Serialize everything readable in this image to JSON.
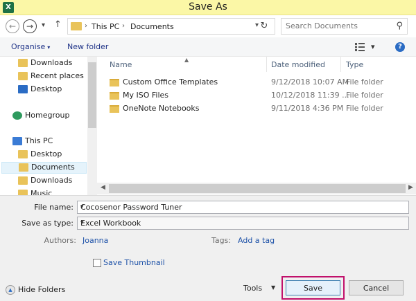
{
  "window": {
    "title": "Save As",
    "app_icon": "X"
  },
  "nav": {
    "back_glyph": "←",
    "forward_glyph": "→",
    "history_glyph": "▾",
    "up_glyph": "↑",
    "path": [
      "This PC",
      "Documents"
    ],
    "separator": "›",
    "address_dropdown": "▾",
    "refresh_glyph": "↻",
    "search_placeholder": "Search Documents",
    "search_glyph": "⚲"
  },
  "toolbar": {
    "organise_label": "Organise",
    "organise_dd": "▾",
    "new_folder_label": "New folder",
    "view_dd": "▾",
    "help_glyph": "?"
  },
  "sidebar": {
    "items": [
      {
        "label": "Downloads",
        "icon": "folder-download-icon",
        "color": "#e9c35a"
      },
      {
        "label": "Recent places",
        "icon": "recent-places-icon",
        "color": "#e9c35a"
      },
      {
        "label": "Desktop",
        "icon": "desktop-icon",
        "color": "#2b6cc4"
      },
      {
        "label": "Homegroup",
        "icon": "homegroup-icon",
        "color": "#2e9a5e"
      },
      {
        "label": "This PC",
        "icon": "computer-icon",
        "color": "#3a7bd5"
      },
      {
        "label": "Desktop",
        "icon": "folder-icon",
        "color": "#e9c35a"
      },
      {
        "label": "Documents",
        "icon": "folder-documents-icon",
        "color": "#e9c35a",
        "selected": true
      },
      {
        "label": "Downloads",
        "icon": "folder-download-icon",
        "color": "#e9c35a"
      },
      {
        "label": "Music",
        "icon": "folder-music-icon",
        "color": "#e9c35a"
      }
    ]
  },
  "files": {
    "columns": [
      "Name",
      "Date modified",
      "Type"
    ],
    "sort_glyph": "▲",
    "rows": [
      {
        "name": "Custom Office Templates",
        "date": "9/12/2018 10:07 AM",
        "type": "File folder"
      },
      {
        "name": "My ISO Files",
        "date": "10/12/2018 11:39 ...",
        "type": "File folder"
      },
      {
        "name": "OneNote Notebooks",
        "date": "9/11/2018 4:36 PM",
        "type": "File folder"
      }
    ],
    "scroll_left": "◀",
    "scroll_right": "▶"
  },
  "form": {
    "file_name_label": "File name:",
    "file_name_value": "Cocosenor Password Tuner",
    "save_type_label": "Save as type:",
    "save_type_value": "Excel Workbook",
    "dropdown_glyph": "▾",
    "authors_label": "Authors:",
    "authors_value": "Joanna",
    "tags_label": "Tags:",
    "tags_value": "Add a tag",
    "save_thumbnail_label": "Save Thumbnail"
  },
  "footer": {
    "hide_folders_label": "Hide Folders",
    "hide_glyph": "▲",
    "tools_label": "Tools",
    "tools_dd": "▼",
    "save_label": "Save",
    "cancel_label": "Cancel"
  },
  "colors": {
    "titlebar": "#fbf7a6",
    "highlight": "#c1106b",
    "link": "#1e52a8"
  }
}
